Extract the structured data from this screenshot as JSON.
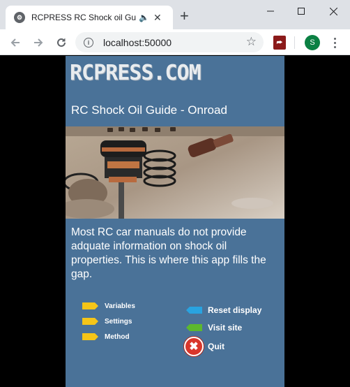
{
  "browser": {
    "tab_title": "RCPRESS RC Shock oil Guid",
    "url": "localhost:50000",
    "avatar_initial": "S",
    "favicon_glyph": "⚙",
    "audio_glyph": "🔈",
    "close_glyph": "✕",
    "new_tab_glyph": "+",
    "pdf_glyph": "⮫"
  },
  "app": {
    "logo": "RCPRESS.COM",
    "title": "RC Shock Oil Guide - Onroad",
    "intro": "Most RC car manuals do not provide adquate information on shock oil properties. This is where this app fills the gap.",
    "menu": [
      {
        "label": "Variables",
        "color": "#f5c518"
      },
      {
        "label": "Settings",
        "color": "#f5c518"
      },
      {
        "label": "Method",
        "color": "#f5c518"
      }
    ],
    "actions": {
      "reset_label": "Reset display",
      "reset_color": "#29a3e0",
      "visit_label": "Visit site",
      "visit_color": "#5cb82e",
      "quit_label": "Quit",
      "quit_color": "#d9362b"
    }
  }
}
